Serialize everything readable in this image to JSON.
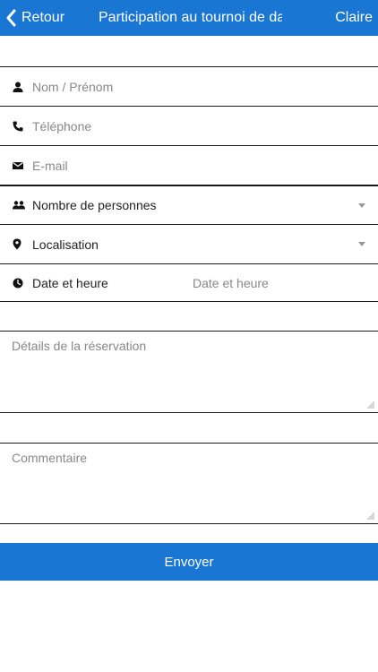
{
  "header": {
    "back_label": "Retour",
    "title": "Participation au tournoi de da",
    "user_name": "Claire",
    "color": "#1976d2"
  },
  "form": {
    "name": {
      "placeholder": "Nom / Prénom",
      "icon": "person-icon"
    },
    "phone": {
      "placeholder": "Téléphone",
      "icon": "phone-icon"
    },
    "email": {
      "placeholder": "E-mail",
      "icon": "envelope-icon"
    },
    "people": {
      "label": "Nombre de personnes",
      "icon": "group-icon"
    },
    "location": {
      "label": "Localisation",
      "icon": "map-pin-icon"
    },
    "datetime": {
      "label": "Date et heure",
      "value": "Date et heure",
      "icon": "clock-icon"
    },
    "details": {
      "placeholder": "Détails de la réservation"
    },
    "comment": {
      "placeholder": "Commentaire"
    }
  },
  "submit": {
    "label": "Envoyer"
  }
}
